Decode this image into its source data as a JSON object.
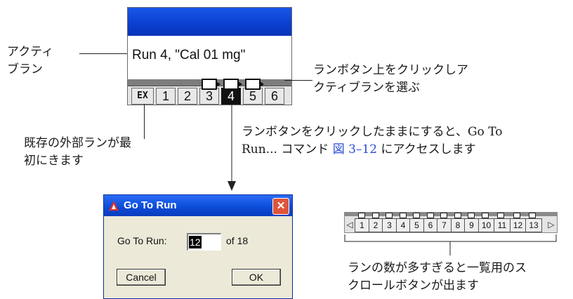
{
  "callouts": {
    "active_run_line1": "アクティ",
    "active_run_line2": "ブラン",
    "click_run_line1": "ランボタン上をクリックしア",
    "click_run_line2": "クティブランを選ぶ",
    "external_line1": "既存の外部ランが最",
    "external_line2": "初にきます",
    "hold_line1": "ランボタンをクリックしたままにすると、Go To",
    "hold_line2_a": "Run... コマンド ",
    "hold_line2_link": "図 3–12",
    "hold_line2_b": " にアクセスします",
    "scroll_line1": "ランの数が多すぎると一覧用のス",
    "scroll_line2": "クロールボタンが出ます"
  },
  "run_window": {
    "run_label": "Run 4, \"Cal 01 mg\"",
    "buttons": [
      {
        "label": "EX",
        "active": false,
        "flag": false
      },
      {
        "label": "1",
        "active": false,
        "flag": false
      },
      {
        "label": "2",
        "active": false,
        "flag": false
      },
      {
        "label": "3",
        "active": false,
        "flag": true
      },
      {
        "label": "4",
        "active": true,
        "flag": true
      },
      {
        "label": "5",
        "active": false,
        "flag": true
      },
      {
        "label": "6",
        "active": false,
        "flag": false
      }
    ]
  },
  "dialog": {
    "title": "Go To Run",
    "field_label": "Go To Run:",
    "field_value": "12",
    "of_text": "of 18",
    "cancel_label": "Cancel",
    "ok_label": "OK",
    "close_glyph": "✕",
    "icon": "app-icon"
  },
  "scroll_strip": {
    "left_arrow": "◁",
    "right_arrow": "▷",
    "buttons": [
      "1",
      "2",
      "3",
      "4",
      "5",
      "6",
      "7",
      "8",
      "9",
      "10",
      "11",
      "12",
      "13"
    ]
  },
  "colors": {
    "titlebar": "#0b4ad6",
    "link": "#2b4fd8",
    "close": "#e0553a"
  }
}
